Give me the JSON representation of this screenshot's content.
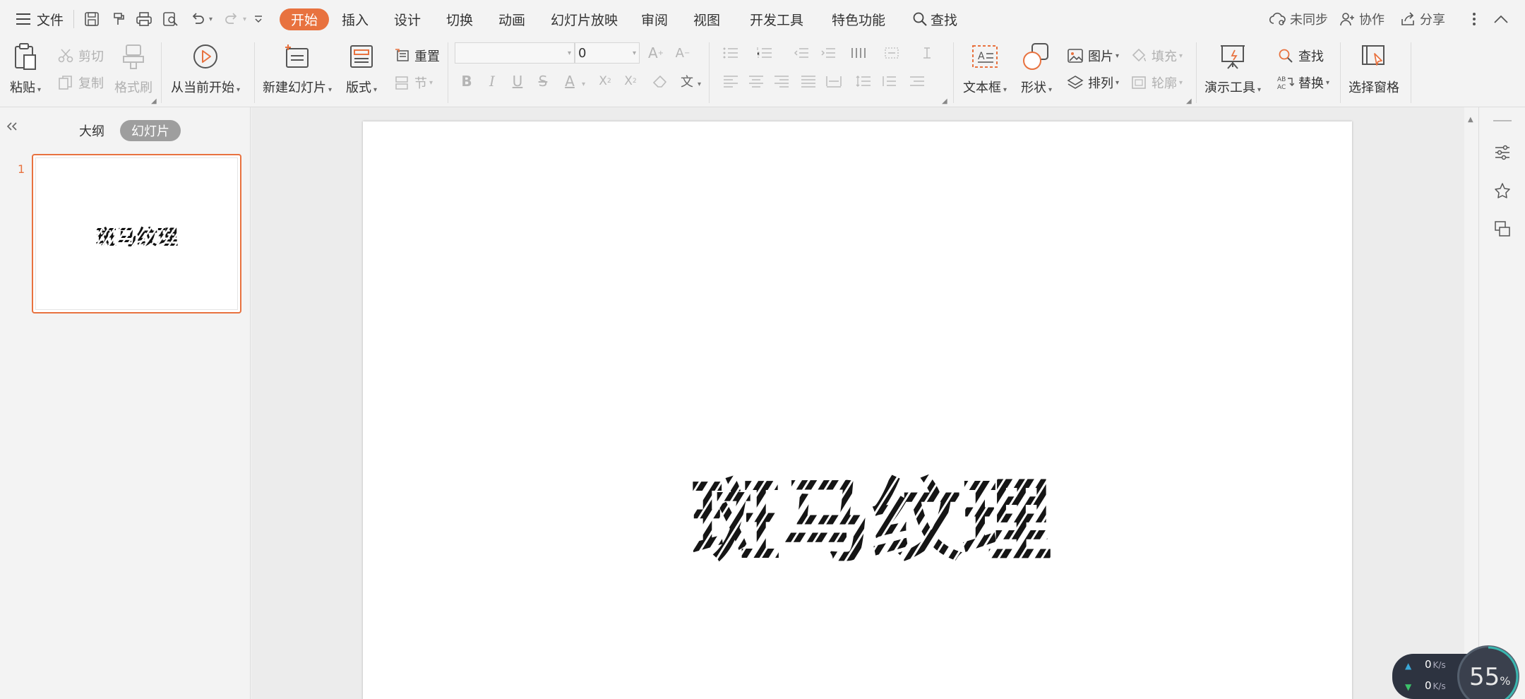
{
  "menubar": {
    "file_label": "文件",
    "tabs": [
      {
        "label": "开始",
        "active": true
      },
      {
        "label": "插入"
      },
      {
        "label": "设计"
      },
      {
        "label": "切换"
      },
      {
        "label": "动画"
      },
      {
        "label": "幻灯片放映"
      },
      {
        "label": "审阅"
      },
      {
        "label": "视图"
      },
      {
        "label": "开发工具"
      },
      {
        "label": "特色功能"
      }
    ],
    "search_label": "查找",
    "sync_label": "未同步",
    "collab_label": "协作",
    "share_label": "分享"
  },
  "ribbon": {
    "paste": "粘贴",
    "cut": "剪切",
    "copy": "复制",
    "format_painter": "格式刷",
    "play_from_current": "从当前开始",
    "new_slide": "新建幻灯片",
    "layout": "版式",
    "reset": "重置",
    "section": "节",
    "font_name": "",
    "font_size": "0",
    "textbox": "文本框",
    "shape": "形状",
    "picture": "图片",
    "fill": "填充",
    "arrange": "排列",
    "outline": "轮廓",
    "presentation_tools": "演示工具",
    "find": "查找",
    "replace": "替换",
    "selection_pane": "选择窗格"
  },
  "leftpanel": {
    "outline_tab": "大纲",
    "slides_tab": "幻灯片",
    "slide_number": "1"
  },
  "slide": {
    "title": "斑马纹理"
  },
  "network": {
    "upload": "0",
    "download": "0",
    "unit": "K/s",
    "percent": "55",
    "percent_sign": "%"
  },
  "colors": {
    "accent": "#e8723f",
    "active_tab_text": "#ffffff",
    "disabled_text": "#b0b0b0"
  }
}
